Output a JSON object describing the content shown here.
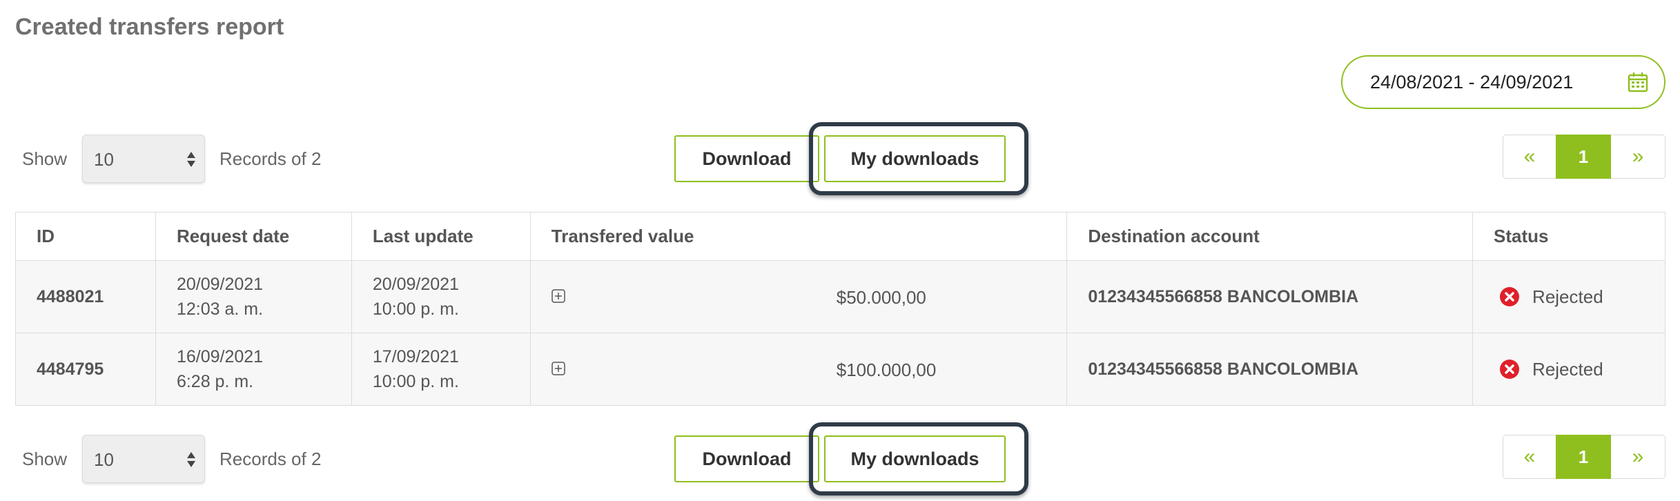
{
  "page": {
    "title": "Created transfers report"
  },
  "date_range": {
    "value": "24/08/2021 - 24/09/2021",
    "icon": "calendar-icon"
  },
  "toolbar": {
    "show_label": "Show",
    "page_size": "10",
    "records_text": "Records of 2",
    "download_label": "Download",
    "my_downloads_label": "My downloads"
  },
  "pagination": {
    "prev": "«",
    "current": "1",
    "next": "»"
  },
  "table": {
    "headers": [
      "ID",
      "Request date",
      "Last update",
      "Transfered value",
      "Destination account",
      "Status"
    ],
    "rows": [
      {
        "id": "4488021",
        "request_date": "20/09/2021",
        "request_time": "12:03 a. m.",
        "last_update_date": "20/09/2021",
        "last_update_time": "10:00 p. m.",
        "value": "$50.000,00",
        "account": "01234345566858 BANCOLOMBIA",
        "status": "Rejected"
      },
      {
        "id": "4484795",
        "request_date": "16/09/2021",
        "request_time": "6:28 p. m.",
        "last_update_date": "17/09/2021",
        "last_update_time": "10:00 p. m.",
        "value": "$100.000,00",
        "account": "01234345566858 BANCOLOMBIA",
        "status": "Rejected"
      }
    ]
  },
  "colors": {
    "accent": "#8fbf1e",
    "rejected": "#e0202a",
    "highlight_border": "#2f3b48"
  }
}
